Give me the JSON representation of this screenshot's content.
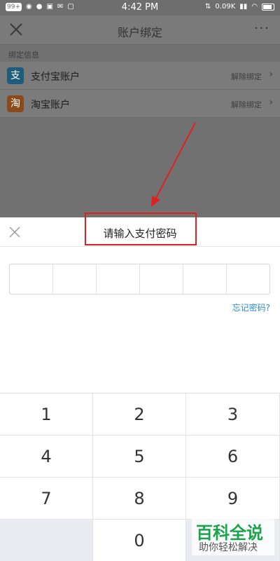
{
  "status_bar": {
    "badge": "99+",
    "time": "4:42 PM",
    "speed": "0.09K"
  },
  "nav": {
    "title": "账户绑定",
    "more": "···"
  },
  "section": {
    "header": "绑定信息"
  },
  "accounts": [
    {
      "icon_char": "支",
      "label": "支付宝账户",
      "action": "解除绑定"
    },
    {
      "icon_char": "淘",
      "label": "淘宝账户",
      "action": "解除绑定"
    }
  ],
  "panel": {
    "title": "请输入支付密码",
    "forgot": "忘记密码?"
  },
  "keypad": {
    "keys": [
      "1",
      "2",
      "3",
      "4",
      "5",
      "6",
      "7",
      "8",
      "9",
      "",
      "0",
      ""
    ]
  },
  "watermark": {
    "title": "百科全说",
    "subtitle": "助你轻松解决"
  },
  "colors": {
    "highlight": "#e02020",
    "link": "#2a8bd0",
    "watermark": "#1aa34a"
  }
}
